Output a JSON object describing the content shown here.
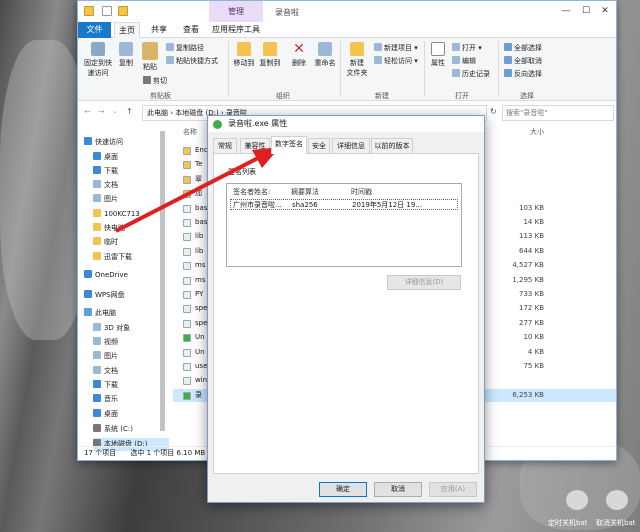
{
  "window": {
    "title": "录音啦",
    "context_tab": "管理",
    "tabs": [
      "文件",
      "主页",
      "共享",
      "查看",
      "应用程序工具"
    ],
    "minimize": "—",
    "maximize": "☐",
    "close": "✕"
  },
  "ribbon": {
    "pin_label": "固定到快\n速访问",
    "copy": "复制",
    "paste": "粘贴",
    "copy_path": "复制路径",
    "paste_shortcut": "粘贴快捷方式",
    "cut": "剪切",
    "move_to": "移动到",
    "copy_to": "复制到",
    "delete": "删除",
    "rename": "重命名",
    "new_folder": "新建\n文件夹",
    "new_item": "新建项目 ▾",
    "easy_access": "轻松访问 ▾",
    "properties": "属性",
    "open": "打开 ▾",
    "edit": "编辑",
    "history": "历史记录",
    "select_all": "全部选择",
    "select_none": "全部取消",
    "invert": "反向选择",
    "groups": {
      "clipboard": "剪贴板",
      "organize": "组织",
      "new": "新建",
      "open": "打开",
      "select": "选择"
    }
  },
  "address": {
    "path": "此电脑  ›  本地磁盘 (D:)  ›  录音啦",
    "search_placeholder": "搜索\"录音啦\""
  },
  "nav": {
    "items": [
      "快速访问",
      "桌面",
      "下载",
      "文档",
      "图片",
      "100KC713",
      "快电脑",
      "临时",
      "迅雷下载",
      "OneDrive",
      "WPS网盘",
      "此电脑",
      "3D 对象",
      "视频",
      "图片",
      "文档",
      "下载",
      "音乐",
      "桌面",
      "系统 (C:)",
      "本地磁盘 (D:)"
    ]
  },
  "files": {
    "header_name": "名称",
    "header_size": "大小",
    "names": [
      "Enc",
      "Te",
      "翠",
      "加",
      "bas",
      "bas",
      "lib",
      "lib",
      "ms",
      "ms",
      "PY",
      "spe",
      "spe",
      "Un",
      "Un",
      "use",
      "win",
      "录"
    ],
    "sizes": [
      "",
      "",
      "",
      "",
      "103 KB",
      "14 KB",
      "113 KB",
      "644 KB",
      "4,527 KB",
      "1,295 KB",
      "733 KB",
      "172 KB",
      "277 KB",
      "10 KB",
      "4 KB",
      "75 KB",
      "",
      "6,253 KB"
    ]
  },
  "status": {
    "count": "17 个项目",
    "selected": "选中 1 个项目  6.10 MB"
  },
  "dialog": {
    "title": "录音啦.exe 属性",
    "tabs": [
      "常规",
      "兼容性",
      "数字签名",
      "安全",
      "详细信息",
      "以前的版本"
    ],
    "list_label": "签名列表",
    "columns": [
      "签名者姓名:",
      "摘要算法",
      "时间戳"
    ],
    "row": {
      "name": "广州市录音啦...",
      "algo": "sha256",
      "time": "2019年5月12日 19..."
    },
    "details_button": "详细信息(D)",
    "ok": "确定",
    "cancel": "取消",
    "apply": "应用(A)"
  },
  "taskbar": {
    "left": "定时关机bat",
    "right": "取消关机bat"
  },
  "colors": {
    "accent": "#1979ca",
    "arrow": "#e02020",
    "folder": "#f4c44e"
  }
}
